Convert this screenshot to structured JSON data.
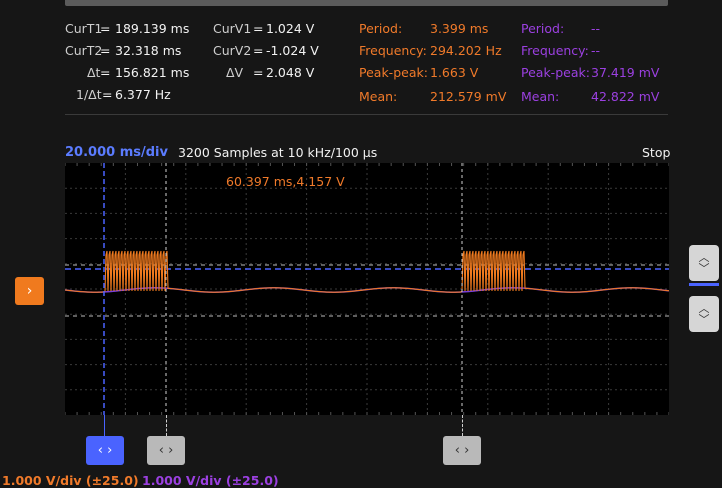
{
  "measurements": {
    "cursors": [
      {
        "label": "CurT1",
        "eq": "=",
        "value": "189.139 ms"
      },
      {
        "label": "CurT2",
        "eq": "=",
        "value": "32.318 ms"
      },
      {
        "label": "Δt",
        "eq": "=",
        "value": "156.821 ms"
      },
      {
        "label": "1/Δt",
        "eq": "=",
        "value": "6.377 Hz"
      }
    ],
    "voltage_cursors": [
      {
        "label": "CurV1",
        "eq": "=",
        "value": "1.024 V"
      },
      {
        "label": "CurV2",
        "eq": "=",
        "value": "-1.024 V"
      },
      {
        "label": "ΔV",
        "eq": "=",
        "value": "2.048 V"
      }
    ],
    "channel1": [
      {
        "label": "Period:",
        "value": "3.399 ms"
      },
      {
        "label": "Frequency:",
        "value": "294.202 Hz"
      },
      {
        "label": "Peak-peak:",
        "value": "1.663 V"
      },
      {
        "label": "Mean:",
        "value": "212.579 mV"
      }
    ],
    "channel2": [
      {
        "label": "Period:",
        "value": "--"
      },
      {
        "label": "Frequency:",
        "value": "--"
      },
      {
        "label": "Peak-peak:",
        "value": "37.419 mV"
      },
      {
        "label": "Mean:",
        "value": "42.822 mV"
      }
    ]
  },
  "header": {
    "time_div": "20.000 ms/div",
    "samples": "3200 Samples at 10 kHz/100 µs",
    "run_state": "Stop"
  },
  "plot": {
    "annotation": "60.397 ms,4.157 V"
  },
  "footer": {
    "ch1_scale": "1.000 V/div (±25.0)",
    "ch2_scale": "1.000 V/div (±25.0)"
  },
  "colors": {
    "ch1": "#f07a2a",
    "ch2": "#9b40e0",
    "cursor": "#4a63ff",
    "background": "#161616"
  },
  "icons": {
    "trigger_marker": "chevron-right-icon",
    "cursor_handle": "horizontal-arrows-icon",
    "level_handle": "vertical-arrows-icon"
  }
}
